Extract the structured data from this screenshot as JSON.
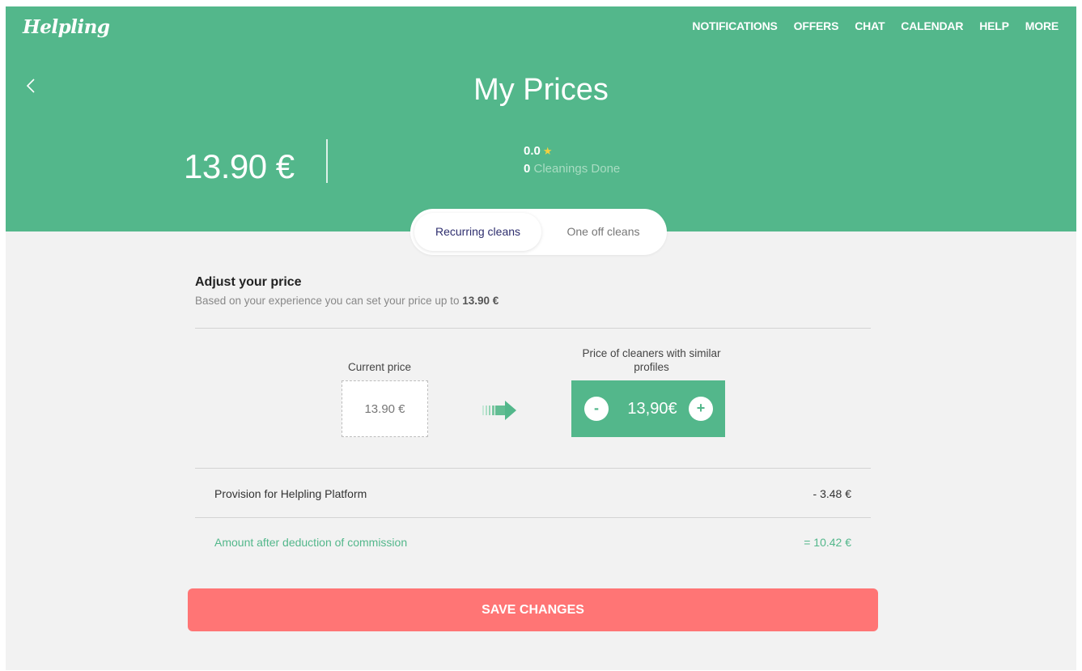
{
  "app": {
    "logo": "Helpling"
  },
  "nav": {
    "items": [
      "NOTIFICATIONS",
      "OFFERS",
      "CHAT",
      "CALENDAR",
      "HELP",
      "MORE"
    ]
  },
  "header": {
    "title": "My Prices",
    "price": "13.90 €",
    "rating": "0.0",
    "cleanings_count": "0",
    "cleanings_label": "Cleanings Done"
  },
  "tabs": {
    "recurring": "Recurring cleans",
    "one_off": "One off cleans",
    "active": "recurring"
  },
  "adjust": {
    "heading": "Adjust your price",
    "subtitle_prefix": "Based on your experience you can set your price up to",
    "subtitle_value": "13.90 €"
  },
  "current_price": {
    "label": "Current price",
    "value": "13.90 €"
  },
  "similar_price": {
    "label": "Price of cleaners with similar profiles",
    "value": "13,90€",
    "minus": "-",
    "plus": "+"
  },
  "provision": {
    "label": "Provision for Helpling Platform",
    "value": "- 3.48 €"
  },
  "amount": {
    "label": "Amount after deduction of commission",
    "value": "= 10.42 €"
  },
  "save_button": {
    "label": "SAVE CHANGES"
  },
  "colors": {
    "brand_green": "#53b78b",
    "save_red": "#ff7575",
    "background": "#f2f2f2",
    "star": "#f4d03f"
  },
  "icons": {
    "back": "chevron-left-icon",
    "rating": "star-icon",
    "transition": "arrow-right-icon"
  }
}
